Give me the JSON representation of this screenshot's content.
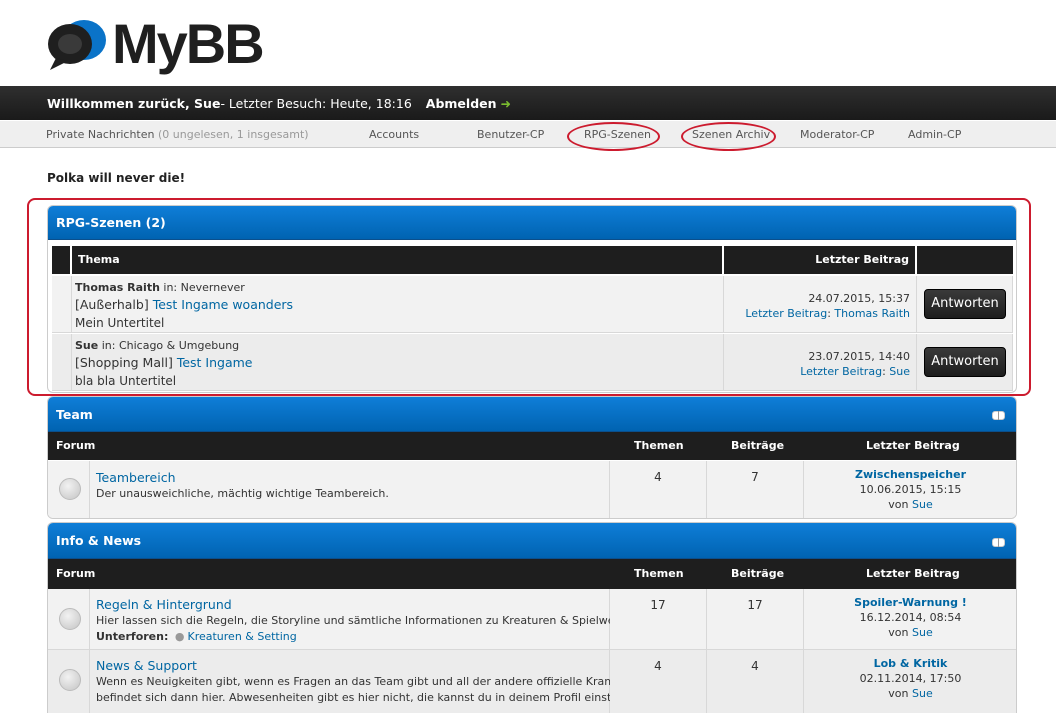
{
  "header": {
    "logo_text": "MyBB"
  },
  "welcome": {
    "prefix": "Willkommen zurück, Sue",
    "last_visit": " - Letzter Besuch: Heute, 18:16",
    "logout": "Abmelden",
    "arrow": "➜"
  },
  "nav": {
    "pm_label": "Private Nachrichten",
    "pm_count": "(0 ungelesen, 1 insgesamt)",
    "items": [
      "Accounts",
      "Benutzer-CP",
      "RPG-Szenen",
      "Szenen Archiv",
      "Moderator-CP",
      "Admin-CP"
    ]
  },
  "motd": "Polka will never die!",
  "rpg": {
    "title": "RPG-Szenen (2)",
    "col_thema": "Thema",
    "col_last": "Letzter Beitrag",
    "btn": "Antworten",
    "rows": [
      {
        "author": "Thomas Raith",
        "in": " in: ",
        "place": "Nevernever",
        "prefix": "[Außerhalb]",
        "title": "Test Ingame woanders",
        "subtitle": "Mein Untertitel",
        "date": "24.07.2015, 15:37",
        "last_label": "Letzter Beitrag",
        "sep": ": ",
        "last_user": "Thomas Raith"
      },
      {
        "author": "Sue",
        "in": " in: ",
        "place": "Chicago & Umgebung",
        "prefix": "[Shopping Mall]",
        "title": "Test Ingame",
        "subtitle": "bla bla Untertitel",
        "date": "23.07.2015, 14:40",
        "last_label": "Letzter Beitrag",
        "sep": ": ",
        "last_user": "Sue"
      }
    ]
  },
  "team": {
    "title": "Team",
    "col_forum": "Forum",
    "col_themen": "Themen",
    "col_beitraege": "Beiträge",
    "col_last": "Letzter Beitrag",
    "rows": [
      {
        "name": "Teambereich",
        "desc": "Der unausweichliche, mächtig wichtige Teambereich.",
        "themen": "4",
        "beitraege": "7",
        "last_title": "Zwischenspeicher",
        "last_date": "10.06.2015, 15:15",
        "von": "von ",
        "last_user": "Sue"
      }
    ]
  },
  "info": {
    "title": "Info & News",
    "col_forum": "Forum",
    "col_themen": "Themen",
    "col_beitraege": "Beiträge",
    "col_last": "Letzter Beitrag",
    "rows": [
      {
        "name": "Regeln & Hintergrund",
        "desc": "Hier lassen sich die Regeln, die Storyline und sämtliche Informationen zu Kreaturen & Spielwelt finden.",
        "sub_label": "Unterforen:",
        "sub_item": "Kreaturen & Setting",
        "themen": "17",
        "beitraege": "17",
        "last_title": "Spoiler-Warnung !",
        "last_date": "16.12.2014, 08:54",
        "von": "von ",
        "last_user": "Sue"
      },
      {
        "name": "News & Support",
        "desc1": "Wenn es Neuigkeiten gibt, wenn es Fragen an das Team gibt und all der andere offizielle Kram, der",
        "desc2": "befindet sich dann hier. Abwesenheiten gibt es hier nicht, die kannst du in deinem Profil einstellen.",
        "themen": "4",
        "beitraege": "4",
        "last_title": "Lob & Kritik",
        "last_date": "02.11.2014, 17:50",
        "von": "von ",
        "last_user": "Sue"
      }
    ]
  },
  "colors": {
    "accent_blue": "#0a73c8",
    "annotation_red": "#cc1b2e",
    "dark": "#1e1e1e"
  }
}
